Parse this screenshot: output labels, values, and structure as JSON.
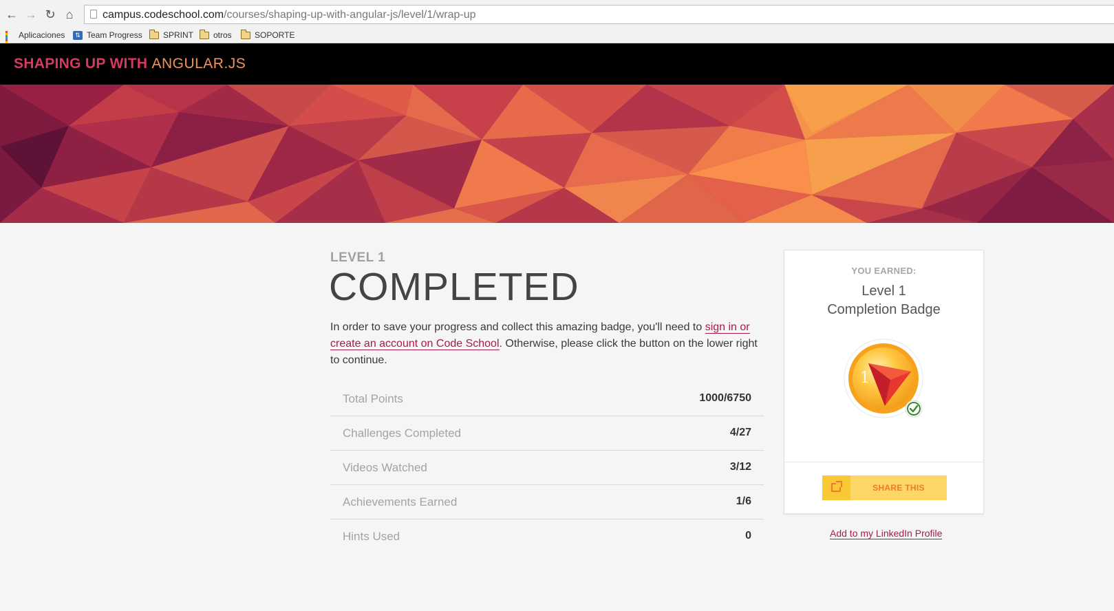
{
  "browser": {
    "url_host": "campus.codeschool.com",
    "url_path": "/courses/shaping-up-with-angular-js/level/1/wrap-up",
    "bookmarks": [
      {
        "label": "Aplicaciones",
        "icon": "apps-grid-icon"
      },
      {
        "label": "Team Progress",
        "icon": "team-progress-icon"
      },
      {
        "label": "SPRINT",
        "icon": "folder-icon"
      },
      {
        "label": "otros",
        "icon": "folder-icon"
      },
      {
        "label": "SOPORTE",
        "icon": "folder-icon"
      }
    ]
  },
  "header": {
    "course_title_part1": "SHAPING UP WITH",
    "course_title_part2": "ANGULAR.JS"
  },
  "main": {
    "level_label": "LEVEL 1",
    "status_title": "COMPLETED",
    "intro_before": "In order to save your progress and collect this amazing badge, you'll need to ",
    "intro_link": "sign in or create an account on Code School",
    "intro_after": ". Otherwise, please click the button on the lower right to continue.",
    "stats": [
      {
        "label": "Total Points",
        "value": "1000/6750"
      },
      {
        "label": "Challenges Completed",
        "value": "4/27"
      },
      {
        "label": "Videos Watched",
        "value": "3/12"
      },
      {
        "label": "Achievements Earned",
        "value": "1/6"
      },
      {
        "label": "Hints Used",
        "value": "0"
      }
    ]
  },
  "badge": {
    "earned_label": "YOU EARNED:",
    "name_line1": "Level 1",
    "name_line2": "Completion Badge",
    "badge_number": "1",
    "share_label": "SHARE THIS",
    "linkedin_label": "Add to my LinkedIn Profile"
  },
  "colors": {
    "accent_link": "#a8194e",
    "share_button": "#fcd768",
    "share_text": "#ef7a2a",
    "header_bg": "#000000"
  }
}
